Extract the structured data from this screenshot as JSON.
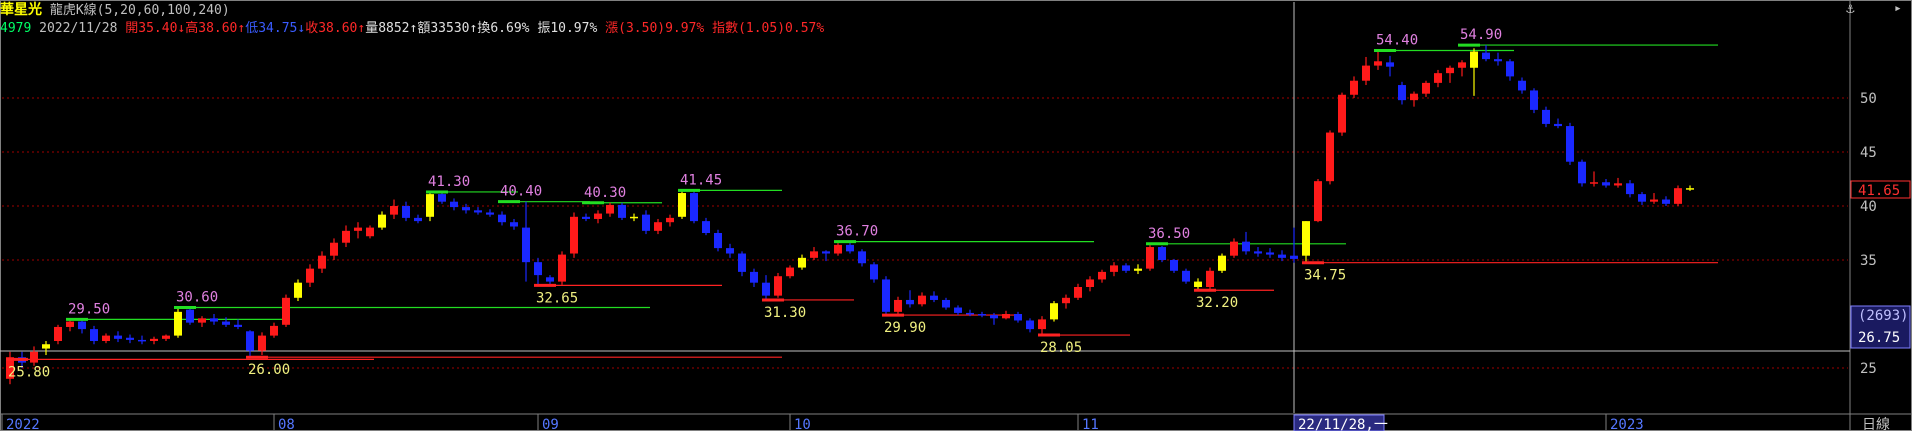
{
  "header": {
    "title": "華星光",
    "indicator": "龍虎K線(5,20,60,100,240)",
    "code": "4979",
    "date": "2022/11/28",
    "open_label": "開",
    "open": "35.40↓",
    "high_label": "高",
    "high": "38.60↑",
    "low_label": "低",
    "low": "34.75↓",
    "close_label": "收",
    "close": "38.60↑",
    "volume_label": "量",
    "volume": "8852↑",
    "amount_label": "額",
    "amount": "33530↑",
    "turnover_label": "換",
    "turnover": "6.69%",
    "amplitude_label": "振",
    "amplitude": "10.97%",
    "change_label": "漲",
    "change": "(3.50)9.97%",
    "index_label": "指數",
    "index": "(1.05)0.57%"
  },
  "colors": {
    "up": "#ff1a1a",
    "down": "#1a28ff",
    "flat_up": "#ffff00",
    "resistance": "#22dd22",
    "support": "#ff2222",
    "high_label": "#e080e0",
    "low_label": "#f0f080",
    "grid": "#a00000",
    "crosshair": "#c0c0c0"
  },
  "chart_data": {
    "type": "candlestick",
    "period": "日線",
    "y_ticks": [
      "50",
      "45",
      "40",
      "35",
      "25"
    ],
    "y_tick_values": [
      50,
      45,
      40,
      35,
      25
    ],
    "x_ticks": [
      "2022",
      "08",
      "09",
      "10",
      "11",
      "2023"
    ],
    "cursor_date": "22/11/28,一",
    "cursor_price_label": "41.65",
    "cursor_price": 41.65,
    "volume_box": "(2693)",
    "lower_value": "26.75",
    "ylim": [
      22,
      56
    ],
    "candles": [
      [
        24.0,
        26.5,
        23.5,
        26.0
      ],
      [
        26.0,
        26.5,
        25.0,
        25.5
      ],
      [
        25.5,
        27.0,
        25.2,
        26.5
      ],
      [
        26.8,
        27.5,
        26.2,
        27.2
      ],
      [
        27.5,
        29.0,
        27.2,
        28.8
      ],
      [
        28.8,
        29.5,
        28.4,
        29.3
      ],
      [
        29.3,
        29.5,
        28.2,
        28.6
      ],
      [
        28.6,
        28.9,
        27.2,
        27.5
      ],
      [
        27.5,
        28.2,
        27.3,
        28.0
      ],
      [
        28.0,
        28.4,
        27.4,
        27.7
      ],
      [
        27.8,
        28.1,
        27.3,
        27.6
      ],
      [
        27.6,
        28.0,
        27.2,
        27.5
      ],
      [
        27.5,
        27.9,
        27.2,
        27.7
      ],
      [
        27.7,
        28.1,
        27.5,
        28.0
      ],
      [
        28.0,
        30.6,
        27.8,
        30.2
      ],
      [
        30.4,
        30.6,
        29.0,
        29.2
      ],
      [
        29.2,
        29.8,
        28.8,
        29.6
      ],
      [
        29.6,
        30.0,
        29.0,
        29.3
      ],
      [
        29.3,
        29.7,
        28.8,
        29.0
      ],
      [
        29.0,
        29.5,
        28.6,
        28.8
      ],
      [
        28.4,
        28.5,
        26.0,
        26.6
      ],
      [
        26.6,
        28.3,
        26.2,
        28.0
      ],
      [
        28.0,
        29.2,
        27.8,
        28.9
      ],
      [
        29.0,
        31.8,
        28.8,
        31.5
      ],
      [
        31.5,
        33.2,
        31.2,
        32.9
      ],
      [
        32.9,
        34.6,
        32.5,
        34.2
      ],
      [
        34.2,
        35.8,
        33.8,
        35.4
      ],
      [
        35.4,
        37.0,
        35.0,
        36.6
      ],
      [
        36.6,
        38.2,
        36.2,
        37.7
      ],
      [
        37.7,
        38.5,
        37.0,
        38.0
      ],
      [
        37.2,
        38.2,
        37.0,
        38.0
      ],
      [
        38.0,
        39.5,
        37.8,
        39.2
      ],
      [
        39.2,
        40.6,
        38.8,
        40.0
      ],
      [
        40.0,
        40.4,
        38.6,
        38.9
      ],
      [
        38.9,
        39.2,
        38.4,
        38.6
      ],
      [
        39.0,
        41.3,
        38.6,
        41.1
      ],
      [
        41.1,
        41.3,
        40.2,
        40.4
      ],
      [
        40.4,
        40.7,
        39.6,
        39.9
      ],
      [
        39.9,
        40.2,
        39.3,
        39.6
      ],
      [
        39.6,
        39.9,
        39.2,
        39.4
      ],
      [
        39.4,
        39.7,
        39.0,
        39.2
      ],
      [
        39.2,
        39.5,
        38.2,
        38.5
      ],
      [
        38.5,
        38.8,
        37.8,
        38.1
      ],
      [
        38.0,
        40.4,
        33.0,
        34.8
      ],
      [
        34.8,
        35.2,
        32.7,
        33.6
      ],
      [
        33.4,
        33.6,
        32.7,
        33.0
      ],
      [
        33.0,
        35.8,
        32.7,
        35.5
      ],
      [
        35.6,
        39.4,
        35.2,
        39.0
      ],
      [
        39.0,
        39.3,
        38.6,
        38.8
      ],
      [
        38.8,
        39.6,
        38.4,
        39.3
      ],
      [
        39.3,
        40.3,
        39.0,
        40.1
      ],
      [
        40.1,
        40.3,
        38.7,
        38.9
      ],
      [
        38.9,
        39.3,
        38.6,
        39.0
      ],
      [
        39.2,
        39.6,
        37.4,
        37.7
      ],
      [
        37.7,
        38.8,
        37.4,
        38.5
      ],
      [
        38.5,
        39.2,
        38.1,
        38.9
      ],
      [
        39.0,
        41.45,
        38.8,
        41.2
      ],
      [
        41.2,
        41.4,
        38.4,
        38.6
      ],
      [
        38.6,
        38.9,
        37.3,
        37.5
      ],
      [
        37.5,
        37.8,
        35.8,
        36.1
      ],
      [
        36.1,
        36.5,
        35.2,
        35.6
      ],
      [
        35.6,
        35.8,
        33.5,
        33.9
      ],
      [
        33.9,
        34.2,
        32.5,
        32.9
      ],
      [
        32.9,
        33.6,
        31.3,
        31.7
      ],
      [
        31.7,
        33.8,
        31.5,
        33.5
      ],
      [
        33.5,
        34.5,
        33.3,
        34.3
      ],
      [
        34.3,
        35.5,
        34.1,
        35.2
      ],
      [
        35.2,
        36.2,
        35.0,
        35.8
      ],
      [
        35.8,
        35.9,
        34.9,
        35.6
      ],
      [
        35.6,
        36.7,
        35.4,
        36.4
      ],
      [
        36.4,
        36.6,
        35.6,
        35.8
      ],
      [
        35.8,
        36.0,
        34.4,
        34.7
      ],
      [
        34.6,
        34.8,
        32.9,
        33.2
      ],
      [
        33.2,
        33.5,
        29.9,
        30.2
      ],
      [
        30.2,
        31.6,
        30.0,
        31.3
      ],
      [
        31.3,
        32.2,
        30.6,
        30.9
      ],
      [
        30.9,
        32.0,
        30.7,
        31.7
      ],
      [
        31.7,
        32.1,
        31.1,
        31.3
      ],
      [
        31.3,
        31.5,
        30.4,
        30.6
      ],
      [
        30.6,
        30.8,
        29.9,
        30.1
      ],
      [
        30.1,
        30.4,
        29.8,
        30.0
      ],
      [
        30.0,
        30.2,
        29.7,
        29.9
      ],
      [
        29.9,
        30.1,
        29.0,
        29.6
      ],
      [
        29.6,
        30.3,
        29.5,
        30.0
      ],
      [
        30.0,
        30.2,
        29.2,
        29.4
      ],
      [
        29.4,
        29.6,
        28.3,
        28.6
      ],
      [
        28.6,
        29.8,
        28.05,
        29.5
      ],
      [
        29.5,
        31.2,
        29.3,
        31.0
      ],
      [
        31.0,
        31.8,
        30.5,
        31.5
      ],
      [
        31.5,
        32.8,
        31.3,
        32.5
      ],
      [
        32.5,
        33.5,
        32.1,
        33.2
      ],
      [
        33.2,
        34.1,
        32.9,
        33.9
      ],
      [
        33.9,
        34.8,
        33.5,
        34.5
      ],
      [
        34.5,
        34.7,
        33.8,
        34.0
      ],
      [
        34.0,
        34.6,
        33.7,
        34.2
      ],
      [
        34.2,
        36.5,
        34.0,
        36.2
      ],
      [
        36.2,
        36.3,
        34.8,
        35.0
      ],
      [
        35.0,
        35.1,
        33.8,
        34.0
      ],
      [
        34.0,
        34.2,
        32.8,
        33.0
      ],
      [
        33.0,
        33.3,
        32.2,
        32.5
      ],
      [
        32.5,
        34.3,
        32.3,
        34.0
      ],
      [
        34.0,
        35.6,
        33.8,
        35.4
      ],
      [
        35.4,
        37.0,
        35.2,
        36.7
      ],
      [
        36.7,
        37.6,
        35.5,
        35.8
      ],
      [
        35.8,
        36.2,
        35.3,
        35.6
      ],
      [
        35.7,
        36.1,
        35.2,
        35.5
      ],
      [
        35.5,
        35.9,
        34.9,
        35.2
      ],
      [
        35.4,
        38.0,
        34.75,
        35.1
      ],
      [
        35.4,
        38.6,
        34.75,
        38.6
      ],
      [
        38.6,
        42.5,
        38.5,
        42.3
      ],
      [
        42.3,
        47.0,
        42.0,
        46.8
      ],
      [
        46.8,
        50.5,
        46.5,
        50.3
      ],
      [
        50.3,
        52.0,
        50.0,
        51.6
      ],
      [
        51.6,
        53.8,
        51.2,
        53.0
      ],
      [
        53.0,
        54.4,
        52.6,
        53.4
      ],
      [
        53.3,
        53.9,
        52.0,
        52.9
      ],
      [
        51.2,
        51.5,
        49.4,
        49.8
      ],
      [
        49.8,
        50.6,
        49.2,
        50.4
      ],
      [
        50.4,
        51.6,
        50.1,
        51.4
      ],
      [
        51.4,
        52.6,
        51.0,
        52.3
      ],
      [
        52.3,
        53.0,
        51.4,
        52.8
      ],
      [
        52.8,
        53.5,
        52.0,
        53.3
      ],
      [
        52.8,
        54.6,
        50.2,
        54.3
      ],
      [
        54.2,
        54.9,
        53.4,
        53.6
      ],
      [
        53.6,
        54.2,
        53.0,
        53.4
      ],
      [
        53.4,
        53.6,
        51.6,
        52.0
      ],
      [
        51.6,
        51.9,
        50.4,
        50.7
      ],
      [
        50.7,
        50.9,
        48.6,
        48.9
      ],
      [
        48.9,
        49.2,
        47.3,
        47.6
      ],
      [
        47.6,
        48.1,
        47.2,
        47.4
      ],
      [
        47.4,
        47.7,
        43.8,
        44.1
      ],
      [
        44.1,
        44.3,
        41.8,
        42.1
      ],
      [
        42.1,
        43.2,
        41.8,
        42.2
      ],
      [
        42.2,
        42.5,
        41.7,
        41.9
      ],
      [
        41.9,
        42.6,
        41.7,
        42.1
      ],
      [
        42.1,
        42.4,
        40.8,
        41.1
      ],
      [
        41.1,
        41.3,
        40.1,
        40.4
      ],
      [
        40.4,
        41.2,
        40.2,
        40.6
      ],
      [
        40.6,
        40.9,
        40.0,
        40.2
      ],
      [
        40.2,
        41.9,
        40.0,
        41.65
      ],
      [
        41.65,
        41.9,
        41.4,
        41.6
      ]
    ],
    "annotations": [
      {
        "kind": "high",
        "text": "29.50",
        "value": 29.5,
        "from": 5,
        "to": 23
      },
      {
        "kind": "low",
        "text": "25.80",
        "value": 25.8,
        "from": 0,
        "to": 30
      },
      {
        "kind": "high",
        "text": "30.60",
        "value": 30.6,
        "from": 14,
        "to": 53
      },
      {
        "kind": "low",
        "text": "26.00",
        "value": 26.0,
        "from": 20,
        "to": 64
      },
      {
        "kind": "high",
        "text": "41.30",
        "value": 41.3,
        "from": 35,
        "to": 42
      },
      {
        "kind": "high",
        "text": "40.40",
        "value": 40.4,
        "from": 41,
        "to": 48
      },
      {
        "kind": "high",
        "text": "40.30",
        "value": 40.3,
        "from": 48,
        "to": 54
      },
      {
        "kind": "low",
        "text": "32.65",
        "value": 32.65,
        "from": 44,
        "to": 59
      },
      {
        "kind": "high",
        "text": "41.45",
        "value": 41.45,
        "from": 56,
        "to": 64
      },
      {
        "kind": "low",
        "text": "31.30",
        "value": 31.3,
        "from": 63,
        "to": 70
      },
      {
        "kind": "high",
        "text": "36.70",
        "value": 36.7,
        "from": 69,
        "to": 90
      },
      {
        "kind": "low",
        "text": "29.90",
        "value": 29.9,
        "from": 73,
        "to": 84
      },
      {
        "kind": "low",
        "text": "28.05",
        "value": 28.05,
        "from": 86,
        "to": 93
      },
      {
        "kind": "high",
        "text": "36.50",
        "value": 36.5,
        "from": 95,
        "to": 111
      },
      {
        "kind": "low",
        "text": "32.20",
        "value": 32.2,
        "from": 99,
        "to": 105
      },
      {
        "kind": "low",
        "text": "34.75",
        "value": 34.75,
        "from": 108,
        "to": 142
      },
      {
        "kind": "high",
        "text": "54.40",
        "value": 54.4,
        "from": 114,
        "to": 125
      },
      {
        "kind": "high",
        "text": "54.90",
        "value": 54.9,
        "from": 121,
        "to": 142
      }
    ]
  }
}
